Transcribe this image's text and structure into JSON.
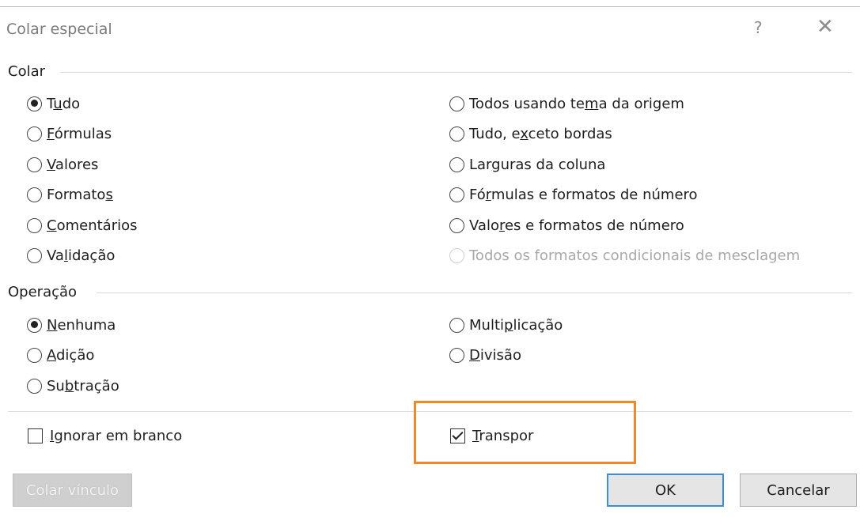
{
  "dialog": {
    "title": "Colar especial",
    "help_glyph": "?",
    "close_glyph": "✕"
  },
  "colar": {
    "label": "Colar",
    "left": [
      {
        "pre": "T",
        "key": "u",
        "post": "do",
        "checked": true
      },
      {
        "pre": "",
        "key": "F",
        "post": "órmulas",
        "checked": false
      },
      {
        "pre": "",
        "key": "V",
        "post": "alores",
        "checked": false
      },
      {
        "pre": "Formato",
        "key": "s",
        "post": "",
        "checked": false
      },
      {
        "pre": "",
        "key": "C",
        "post": "omentários",
        "checked": false
      },
      {
        "pre": "Va",
        "key": "l",
        "post": "idação",
        "checked": false
      }
    ],
    "right": [
      {
        "pre": "Todos usando te",
        "key": "m",
        "post": "a da origem",
        "checked": false,
        "disabled": false
      },
      {
        "pre": "Tudo, e",
        "key": "x",
        "post": "ceto bordas",
        "checked": false,
        "disabled": false
      },
      {
        "pre": "Lar",
        "key": "g",
        "post": "uras da coluna",
        "checked": false,
        "disabled": false
      },
      {
        "pre": "Fó",
        "key": "r",
        "post": "mulas e formatos de número",
        "checked": false,
        "disabled": false
      },
      {
        "pre": "Valo",
        "key": "r",
        "post": "es e formatos de número",
        "checked": false,
        "disabled": false
      },
      {
        "pre": "Todos os formatos condicionais de mesclagem",
        "key": "",
        "post": "",
        "checked": false,
        "disabled": true
      }
    ]
  },
  "operacao": {
    "label": "Operação",
    "left": [
      {
        "pre": "",
        "key": "N",
        "post": "enhuma",
        "checked": true
      },
      {
        "pre": "",
        "key": "A",
        "post": "dição",
        "checked": false
      },
      {
        "pre": "Su",
        "key": "b",
        "post": "tração",
        "checked": false
      }
    ],
    "right": [
      {
        "pre": "Multi",
        "key": "p",
        "post": "licação",
        "checked": false
      },
      {
        "pre": "",
        "key": "D",
        "post": "ivisão",
        "checked": false
      }
    ]
  },
  "checks": {
    "ignorar": {
      "pre": "",
      "key": "I",
      "post": "gnorar em branco",
      "checked": false
    },
    "transpor": {
      "pre": "",
      "key": "T",
      "post": "ranspor",
      "checked": true
    }
  },
  "buttons": {
    "colar_vinculo": "Colar vínculo",
    "ok": "OK",
    "cancelar": "Cancelar"
  },
  "colors": {
    "highlight": "#f0892a",
    "focus_border": "#3c8fd6"
  }
}
